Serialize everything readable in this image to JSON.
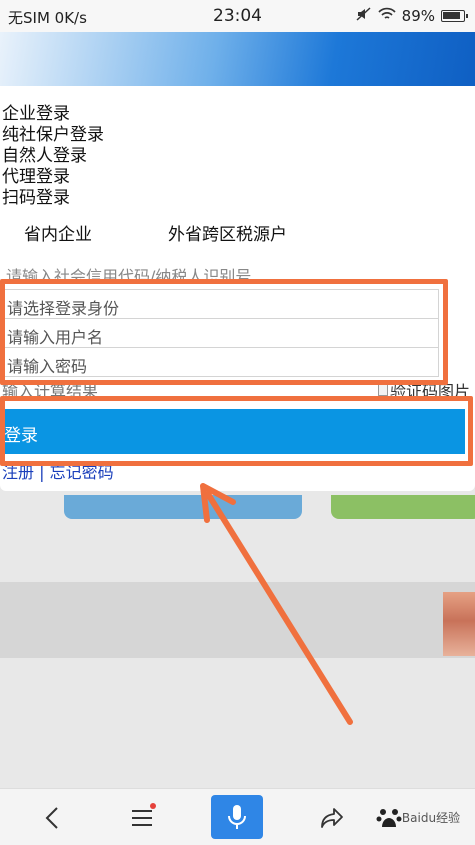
{
  "status_bar": {
    "carrier": "无SIM 0K/s",
    "time": "23:04",
    "battery": "89%"
  },
  "modal": {
    "login_types": [
      "企业登录",
      "纯社保户登录",
      "自然人登录",
      "代理登录",
      "扫码登录"
    ],
    "region_tabs": [
      "省内企业",
      "外省跨区税源户"
    ],
    "fields": {
      "credit_code_placeholder": "请输入社会信用代码/纳税人识别号",
      "role_placeholder": "请选择登录身份",
      "username_placeholder": "请输入用户名",
      "password_placeholder": "请输入密码",
      "captcha_placeholder": "输入计算结果",
      "captcha_image_alt": "验证码图片"
    },
    "login_button": "登录",
    "links": {
      "register": "注册",
      "separator": " | ",
      "forgot": "忘记密码"
    }
  },
  "annotation_color": "#f0703e",
  "toolbar": {
    "icons": [
      "back-icon",
      "menu-icon",
      "microphone-icon",
      "share-icon",
      "baidu-paw-icon"
    ],
    "watermark": "Baidu经验"
  }
}
